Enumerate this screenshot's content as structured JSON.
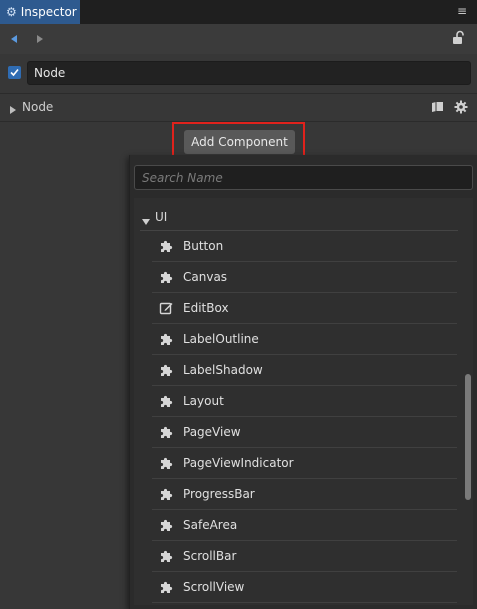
{
  "tab": {
    "title": "Inspector",
    "icon": "gear-icon",
    "menu_glyph": "≡"
  },
  "nav": {
    "back_icon": "triangle-left-icon",
    "forward_icon": "triangle-right-icon",
    "lock_icon": "lock-icon"
  },
  "node": {
    "active": true,
    "name": "Node",
    "section_label": "Node"
  },
  "add_component": {
    "label": "Add Component"
  },
  "popup": {
    "search_placeholder": "Search Name",
    "category": "UI",
    "items": [
      {
        "label": "Button",
        "icon": "puzzle-icon"
      },
      {
        "label": "Canvas",
        "icon": "puzzle-icon"
      },
      {
        "label": "EditBox",
        "icon": "edit-icon"
      },
      {
        "label": "LabelOutline",
        "icon": "puzzle-icon"
      },
      {
        "label": "LabelShadow",
        "icon": "puzzle-icon"
      },
      {
        "label": "Layout",
        "icon": "puzzle-icon"
      },
      {
        "label": "PageView",
        "icon": "puzzle-icon"
      },
      {
        "label": "PageViewIndicator",
        "icon": "puzzle-icon"
      },
      {
        "label": "ProgressBar",
        "icon": "puzzle-icon"
      },
      {
        "label": "SafeArea",
        "icon": "puzzle-icon"
      },
      {
        "label": "ScrollBar",
        "icon": "puzzle-icon"
      },
      {
        "label": "ScrollView",
        "icon": "puzzle-icon"
      }
    ]
  },
  "colors": {
    "accent": "#2e5a8f",
    "highlight": "#e0221c",
    "panel": "#373737",
    "popup": "#2b2b2b"
  }
}
